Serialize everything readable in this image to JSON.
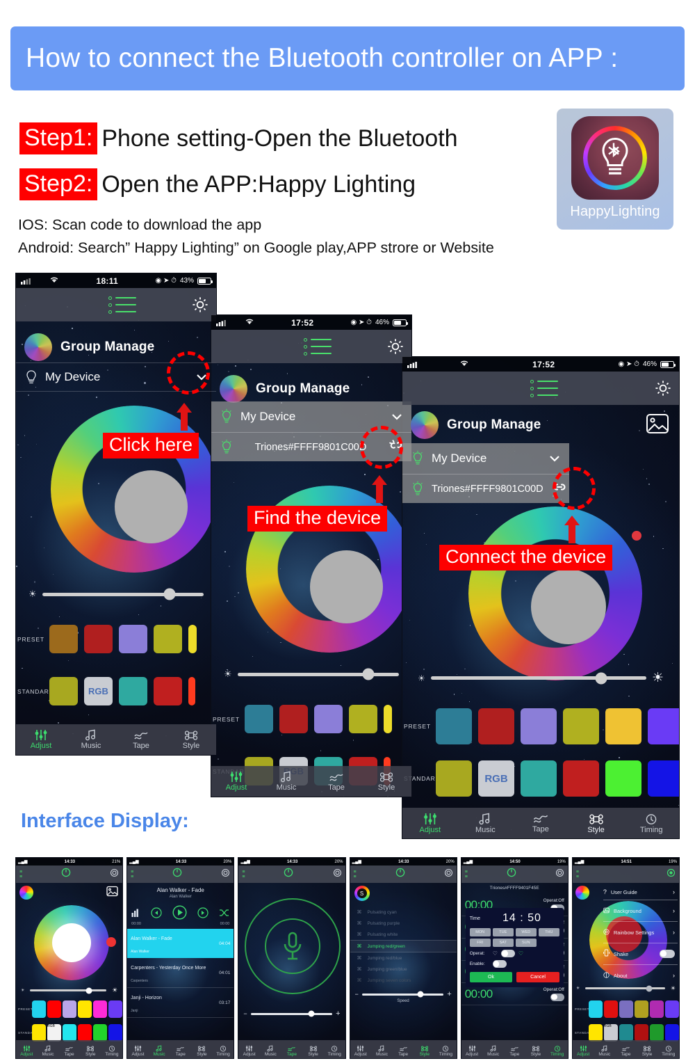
{
  "banner": {
    "title": "How to connect the Bluetooth controller on APP :"
  },
  "steps": [
    {
      "tag": "Step1:",
      "text": "Phone setting-Open the Bluetooth"
    },
    {
      "tag": "Step2:",
      "text": "Open the APP:Happy Lighting"
    }
  ],
  "os_notes": [
    "IOS: Scan code to download the app",
    "Android: Search” Happy Lighting”  on Google play,APP strore or Website"
  ],
  "app_icon": {
    "label": "HappyLighting",
    "icon": "bulb-bluetooth-icon"
  },
  "annotations": {
    "click_here": "Click here",
    "find_device": "Find the device",
    "connect_device": "Connect the device"
  },
  "interface_heading": "Interface Display:",
  "phones": [
    {
      "status": {
        "time": "18:11",
        "battery": "43%"
      },
      "group_title": "Group Manage",
      "my_device": "My Device",
      "rows": {
        "preset_label": "PRESET",
        "standard_label": "STANDARD",
        "rgb_label": "RGB"
      },
      "preset_colors": [
        "#9c6a1c",
        "#b01f1f",
        "#8b7ed8",
        "#b0b020",
        "#eddc2a"
      ],
      "standard_colors": [
        "#a8a820",
        "#c9ccd2",
        "#2fa9a0",
        "#c01f1f",
        "#ff3b1f"
      ],
      "nav": [
        "Adjust",
        "Music",
        "Tape",
        "Style"
      ]
    },
    {
      "status": {
        "time": "17:52",
        "battery": "46%"
      },
      "group_title": "Group Manage",
      "my_device": "My Device",
      "device_name": "Triones#FFFF9801C00D",
      "link_icon": "broken-link-icon",
      "rows": {
        "preset_label": "PRESET",
        "standard_label": "STANDARD",
        "rgb_label": "RGB"
      },
      "preset_colors": [
        "#2d7d96",
        "#b01f1f",
        "#8b7ed8",
        "#b0b020",
        "#eddc2a"
      ],
      "standard_colors": [
        "#a8a820",
        "#c9ccd2",
        "#2fa9a0",
        "#c01f1f",
        "#ff3b1f"
      ],
      "nav": [
        "Adjust",
        "Music",
        "Tape",
        "Style"
      ]
    },
    {
      "status": {
        "time": "17:52",
        "battery": "46%"
      },
      "group_title": "Group Manage",
      "my_device": "My Device",
      "device_name": "Triones#FFFF9801C00D",
      "link_icon": "connected-link-icon",
      "gallery_icon": "image-icon",
      "rows": {
        "preset_label": "PRESET",
        "standard_label": "STANDARD",
        "rgb_label": "RGB"
      },
      "preset_colors": [
        "#2d7d96",
        "#b01f1f",
        "#8b7ed8",
        "#b0b020",
        "#efc233",
        "#6a3bf5"
      ],
      "standard_colors": [
        "#a8a820",
        "#c9ccd2",
        "#2fa9a0",
        "#c01f1f",
        "#4cf032",
        "#1414e6"
      ],
      "nav": [
        "Adjust",
        "Music",
        "Tape",
        "Style",
        "Timing"
      ]
    }
  ],
  "interface_screens": [
    {
      "name": "adjust-screen",
      "status_time": "14:33",
      "status_battery": "21%",
      "rows": {
        "preset_label": "PRESET",
        "standard_label": "STANDARD",
        "rgb_label": "RGB"
      },
      "preset_colors": [
        "#22d3ee",
        "#ff0000",
        "#b9a6ea",
        "#ffe500",
        "#ff2bd6",
        "#6a3bf5"
      ],
      "standard_colors": [
        "#ffe500",
        "#f2f2f2",
        "#22e5ee",
        "#ff0000",
        "#22d32b",
        "#1414e6"
      ],
      "nav": [
        "Adjust",
        "Music",
        "Tape",
        "Style",
        "Timing"
      ],
      "active_nav": "Adjust"
    },
    {
      "name": "music-screen",
      "status_time": "14:33",
      "status_battery": "20%",
      "now_playing": {
        "title": "Alan Walker - Fade",
        "artist": "Alan Walker"
      },
      "time_start": "00:00",
      "time_end": "00:00",
      "tracks": [
        {
          "title": "Alan Walker - Fade",
          "artist": "Alan Walker",
          "duration": "04:04",
          "selected": true
        },
        {
          "title": "Carpenters - Yesterday Once More",
          "artist": "Carpenters",
          "duration": "04:01",
          "selected": false
        },
        {
          "title": "Janji - Horizon",
          "artist": "Janji",
          "duration": "03:17",
          "selected": false
        }
      ],
      "nav": [
        "Adjust",
        "Music",
        "Tape",
        "Style",
        "Timing"
      ],
      "active_nav": "Music"
    },
    {
      "name": "tape-screen",
      "status_time": "14:33",
      "status_battery": "20%",
      "mic_icon": "microphone-icon",
      "minus": "−",
      "plus": "+",
      "nav": [
        "Adjust",
        "Music",
        "Tape",
        "Style",
        "Timing"
      ],
      "active_nav": "Tape"
    },
    {
      "name": "style-screen",
      "status_time": "14:33",
      "status_battery": "20%",
      "styles": [
        {
          "label": "Pulsating cyan",
          "selected": false
        },
        {
          "label": "Pulsating purple",
          "selected": false
        },
        {
          "label": "Pulsating white",
          "selected": false
        },
        {
          "label": "Jumping red/green",
          "selected": true
        },
        {
          "label": "Jumping red/blue",
          "selected": false
        },
        {
          "label": "Jumping green/blue",
          "selected": false
        },
        {
          "label": "Jumping seven colors",
          "selected": false
        }
      ],
      "speed_label": "Speed",
      "minus": "−",
      "plus": "+",
      "nav": [
        "Adjust",
        "Music",
        "Tape",
        "Style",
        "Timing"
      ],
      "active_nav": "Style"
    },
    {
      "name": "timing-screen",
      "status_time": "14:50",
      "status_battery": "19%",
      "device_name": "Triones#FFFF9401F45E",
      "timer_rows": [
        {
          "time": "00:00",
          "operat": "Operat:Off",
          "on": false
        },
        {
          "time": "00:00",
          "operat": "Operat:Off",
          "on": false
        },
        {
          "time": "00:00",
          "operat": "Operat:Off",
          "on": false
        },
        {
          "time": "00:00",
          "operat": "Operat:Off",
          "on": false
        },
        {
          "time": "00:00",
          "operat": "Operat:Off",
          "on": false
        }
      ],
      "dialog": {
        "time_label": "Time",
        "time_value": "14 : 50",
        "days": [
          "MON",
          "TUE",
          "WED",
          "THU",
          "FRI",
          "SAT",
          "SUN"
        ],
        "operat_label": "Operat:",
        "enable_label": "Enable:",
        "ok": "Ok",
        "cancel": "Cancel"
      },
      "nav": [
        "Adjust",
        "Music",
        "Tape",
        "Style",
        "Timing"
      ],
      "active_nav": "Timing"
    },
    {
      "name": "settings-menu-screen",
      "status_time": "14:51",
      "status_battery": "19%",
      "menu": [
        {
          "label": "User Guide",
          "icon": "question-icon",
          "type": "arrow"
        },
        {
          "label": "Background",
          "icon": "image-icon",
          "type": "arrow"
        },
        {
          "label": "Rainbow Settings",
          "icon": "rainbow-icon",
          "type": "arrow"
        },
        {
          "label": "Shake",
          "icon": "shake-icon",
          "type": "toggle"
        },
        {
          "label": "About",
          "icon": "info-icon",
          "type": "arrow"
        }
      ],
      "rows": {
        "preset_label": "PRESET",
        "standard_label": "STANDARD",
        "rgb_label": "RGB"
      },
      "preset_colors": [
        "#22d3ee",
        "#e01010",
        "#7a6fc0",
        "#b0a020",
        "#b02bb0",
        "#6a3bf5"
      ],
      "standard_colors": [
        "#ffe500",
        "#c9ccd2",
        "#1f8a90",
        "#b01010",
        "#1f9a2b",
        "#1414e6"
      ],
      "nav": [
        "Adjust",
        "Music",
        "Tape",
        "Style",
        "Timing"
      ],
      "active_nav": "Adjust"
    }
  ],
  "colors": {
    "banner_bg": "#6b9bf5",
    "accent_red": "#fd0000",
    "heading_blue": "#4a86e8",
    "green": "#3ddc6e"
  }
}
